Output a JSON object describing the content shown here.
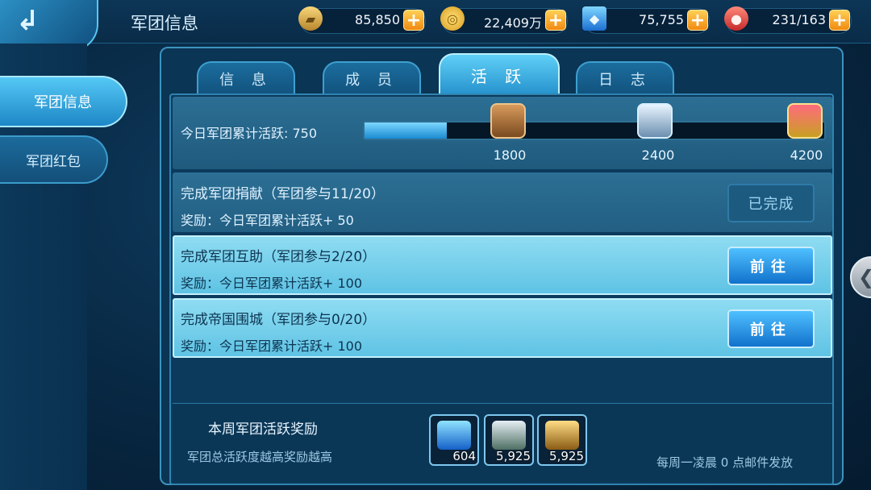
{
  "header": {
    "title": "军团信息",
    "resources": [
      {
        "icon": "gold-bar-icon",
        "value": "85,850"
      },
      {
        "icon": "coin-icon",
        "value": "22,409万"
      },
      {
        "icon": "blue-crystal-icon",
        "value": "75,755"
      },
      {
        "icon": "meat-stamina-icon",
        "value": "231/163"
      }
    ],
    "plus_label": "+"
  },
  "sidebar": {
    "items": [
      {
        "label": "军团信息",
        "active": true
      },
      {
        "label": "军团红包",
        "active": false
      }
    ]
  },
  "tabs": [
    {
      "label": "信 息",
      "active": false
    },
    {
      "label": "成 员",
      "active": false
    },
    {
      "label": "活 跃",
      "active": true
    },
    {
      "label": "日 志",
      "active": false
    }
  ],
  "progress": {
    "label": "今日军团累计活跃:",
    "value": "750",
    "current": 750,
    "max": 4200,
    "milestones": [
      {
        "value": "1800",
        "chest": "bronze-chest-icon"
      },
      {
        "value": "2400",
        "chest": "silver-chest-icon"
      },
      {
        "value": "4200",
        "chest": "gold-chest-icon"
      }
    ]
  },
  "tasks": [
    {
      "title": "完成军团捐献（军团参与11/20）",
      "reward": "奖励：今日军团累计活跃+ 50",
      "button": "已完成",
      "done": true
    },
    {
      "title": "完成军团互助（军团参与2/20）",
      "reward": "奖励：今日军团累计活跃+ 100",
      "button": "前往",
      "done": false
    },
    {
      "title": "完成帝国围城（军团参与0/20）",
      "reward": "奖励：今日军团累计活跃+ 100",
      "button": "前往",
      "done": false
    }
  ],
  "weekly": {
    "title": "本周军团活跃奖励",
    "subtitle": "军团总活跃度越高奖励越高",
    "rewards": [
      {
        "icon": "blue-crystal-icon",
        "count": "604"
      },
      {
        "icon": "silver-medal-icon",
        "count": "5,925"
      },
      {
        "icon": "gold-pile-icon",
        "count": "5,925"
      }
    ],
    "mail_note": "每周一凌晨 0 点邮件发放"
  },
  "colors": {
    "accent": "#2aa6e6",
    "button_go": "#1a8ae0",
    "plus": "#f5a623"
  }
}
